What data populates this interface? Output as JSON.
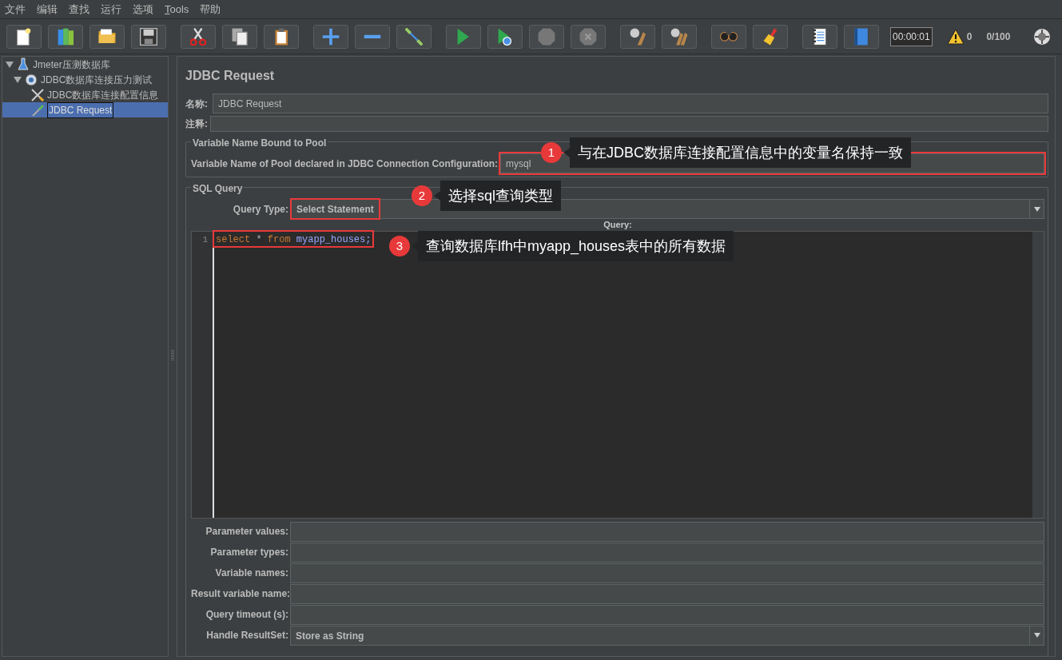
{
  "menu": [
    {
      "label": "文件",
      "mnemonic": false
    },
    {
      "label": "编辑",
      "mnemonic": false
    },
    {
      "label": "查找",
      "mnemonic": false
    },
    {
      "label": "运行",
      "mnemonic": false
    },
    {
      "label": "选项",
      "mnemonic": false
    },
    {
      "label": "Tools",
      "mnemonic": true
    },
    {
      "label": "帮助",
      "mnemonic": false
    }
  ],
  "toolbar": {
    "timer": "00:00:01",
    "warnings": "0",
    "threads": "0/100"
  },
  "tree": [
    {
      "label": "Jmeter压测数据库",
      "kind": "plan",
      "expanded": true,
      "selected": false,
      "children": [
        {
          "label": "JDBC数据库连接压力测试",
          "kind": "group",
          "expanded": true,
          "selected": false,
          "children": [
            {
              "label": "JDBC数据库连接配置信息",
              "kind": "config",
              "selected": false
            },
            {
              "label": "JDBC Request",
              "kind": "sampler",
              "selected": true
            }
          ]
        }
      ]
    }
  ],
  "panel": {
    "title": "JDBC Request",
    "name": {
      "label": "名称:",
      "value": "JDBC Request"
    },
    "comments": {
      "label": "注释:"
    },
    "pool": {
      "legend": "Variable Name Bound to Pool",
      "label": "Variable Name of Pool declared in JDBC Connection Configuration:",
      "value": "mysql",
      "highlighted": true
    },
    "sql": {
      "legend": "SQL Query",
      "query_type": {
        "label": "Query Type:",
        "value": "Select Statement",
        "highlighted": true
      },
      "query_label": "Query:",
      "code": {
        "line_number": "1",
        "highlighted": true,
        "tokens": [
          {
            "text": "select",
            "kind": "keyword"
          },
          {
            "text": " * ",
            "kind": "plain"
          },
          {
            "text": "from",
            "kind": "keyword"
          },
          {
            "text": " myapp_houses;",
            "kind": "identifier"
          }
        ]
      },
      "fields": [
        {
          "label": "Parameter values:"
        },
        {
          "label": "Parameter types:"
        },
        {
          "label": "Variable names:"
        },
        {
          "label": "Result variable name:"
        },
        {
          "label": "Query timeout (s):"
        },
        {
          "label": "Handle ResultSet:",
          "value": "Store as String",
          "kind": "combo"
        }
      ]
    }
  },
  "annotations": [
    {
      "number": "1",
      "text": "与在JDBC数据库连接配置信息中的变量名保持一致"
    },
    {
      "number": "2",
      "text": "选择sql查询类型"
    },
    {
      "number": "3",
      "text": "查询数据库lfh中myapp_houses表中的所有数据"
    }
  ]
}
